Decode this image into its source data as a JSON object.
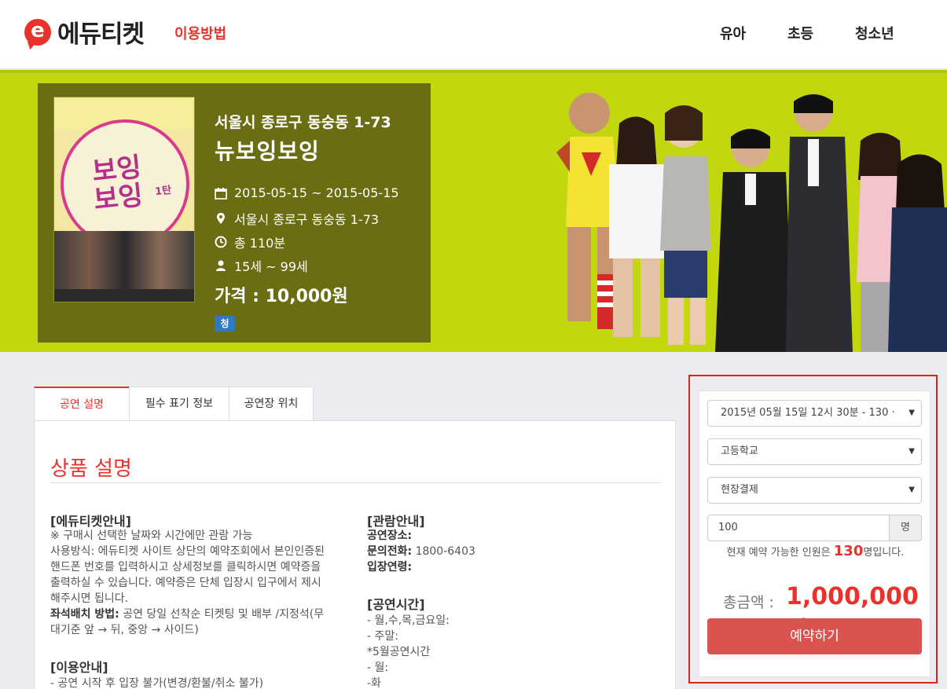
{
  "header": {
    "logo_mark": "e",
    "logo_text": "에듀티켓",
    "howto": "이용방법",
    "nav": [
      "유아",
      "초등",
      "청소년"
    ]
  },
  "hero": {
    "address": "서울시 종로구 동숭동 1-73",
    "title": "뉴보잉보잉",
    "date": "2015-05-15 ~ 2015-05-15",
    "location": "서울시 종로구 동숭동 1-73",
    "duration": "총 110분",
    "age": "15세 ~ 99세",
    "price": "가격 : 10,000원",
    "badge": "청",
    "poster": {
      "title1": "보잉",
      "title2": "보잉",
      "title3": "1탄"
    },
    "icons": [
      "calendar-icon",
      "map-marker-icon",
      "clock-icon",
      "user-icon"
    ],
    "background_color": "#c3d70e",
    "box_color": "#6a6d11"
  },
  "tabs": [
    "공연 설명",
    "필수 표기 정보",
    "공연장 위치"
  ],
  "content": {
    "section_title": "상품 설명",
    "left": {
      "heading1": "[에듀티켓안내]",
      "lines1": [
        "※ 구매시 선택한 날짜와 시간에만 관람 가능",
        "사용방식: 에듀티켓 사이트 상단의 예약조회에서 본인인증된",
        "핸드폰 번호를 입력하시고 상세정보를 클릭하시면 예약증을",
        "출력하실 수 있습니다. 예약증은 단체 입장시 입구에서 제시",
        "해주시면 됩니다."
      ],
      "seat_label": "좌석배치 방법:",
      "seat_text": " 공연 당일 선착순 티켓팅 및 배부 /지정석(무",
      "seat_text2": "대기준 앞 → 뒤, 중앙 → 사이드)",
      "heading2": "[이용안내]",
      "lines2": [
        "- 공연 시작 후 입장 불가(변경/환불/취소 불가)"
      ]
    },
    "right": {
      "heading1": "[관람안내]",
      "venue_label": "공연장소:",
      "phone_label": "문의전화:",
      "phone": " 1800-6403",
      "age_label": "입장연령:",
      "heading2": "[공연시간]",
      "lines2": [
        "- 월,수,목,금요일:",
        "- 주말:",
        "*5월공연시간",
        "- 월:",
        "-화"
      ]
    }
  },
  "booking": {
    "session": "2015년 05월 15일 12시 30분 - 130 ·",
    "school": "고등학교",
    "payment": "현장결제",
    "quantity": "100",
    "unit": "명",
    "avail_prefix": "현재 예약 가능한 인원은 ",
    "avail_num": "130",
    "avail_suffix": "명입니다.",
    "total_label": "총금액 :",
    "total_value": "1,000,000원",
    "button": "예약하기",
    "accent": "#e8322b",
    "button_color": "#d9534f"
  }
}
